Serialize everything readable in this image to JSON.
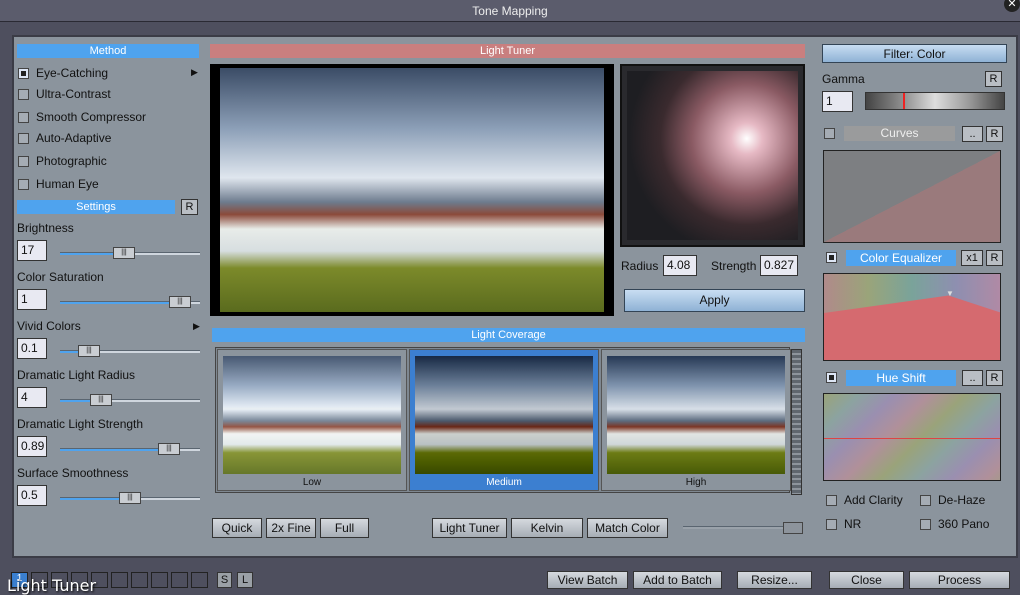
{
  "window": {
    "title": "Tone Mapping"
  },
  "method": {
    "header": "Method",
    "items": [
      {
        "label": "Eye-Catching",
        "selected": true
      },
      {
        "label": "Ultra-Contrast"
      },
      {
        "label": "Smooth Compressor"
      },
      {
        "label": "Auto-Adaptive"
      },
      {
        "label": "Photographic"
      },
      {
        "label": "Human Eye"
      }
    ]
  },
  "settings": {
    "header": "Settings",
    "reset": "R",
    "sliders": [
      {
        "label": "Brightness",
        "value": "17",
        "pos": 0.45
      },
      {
        "label": "Color Saturation",
        "value": "1",
        "pos": 0.92
      },
      {
        "label": "Vivid Colors",
        "value": "0.1",
        "pos": 0.15
      },
      {
        "label": "Dramatic Light Radius",
        "value": "4",
        "pos": 0.25
      },
      {
        "label": "Dramatic Light Strength",
        "value": "0.89",
        "pos": 0.83
      },
      {
        "label": "Surface Smoothness",
        "value": "0.5",
        "pos": 0.5
      }
    ]
  },
  "light_tuner": {
    "header": "Light Tuner",
    "radius_label": "Radius",
    "radius": "4.08",
    "strength_label": "Strength",
    "strength": "0.827",
    "apply": "Apply"
  },
  "coverage": {
    "header": "Light Coverage",
    "thumbs": [
      "Low",
      "Medium",
      "High"
    ],
    "selected": "Medium"
  },
  "bottom_buttons": {
    "quick": "Quick",
    "fine": "2x Fine",
    "full": "Full",
    "light_tuner": "Light Tuner",
    "kelvin": "Kelvin",
    "match_color": "Match Color"
  },
  "filter": {
    "header": "Filter: Color",
    "gamma_label": "Gamma",
    "gamma": "1",
    "reset": "R",
    "curves": "Curves",
    "dots": "..",
    "color_eq": "Color Equalizer",
    "x1": "x1",
    "hue_shift": "Hue Shift",
    "options": [
      {
        "label": "Add Clarity",
        "checked": false
      },
      {
        "label": "De-Haze",
        "checked": false
      },
      {
        "label": "NR",
        "checked": false
      },
      {
        "label": "360 Pano",
        "checked": false
      }
    ]
  },
  "footer": {
    "slot_active": "1",
    "s": "S",
    "l": "L",
    "view_batch": "View Batch",
    "add_batch": "Add to Batch",
    "resize": "Resize...",
    "close": "Close",
    "process": "Process",
    "overlay": "Light Tuner"
  }
}
